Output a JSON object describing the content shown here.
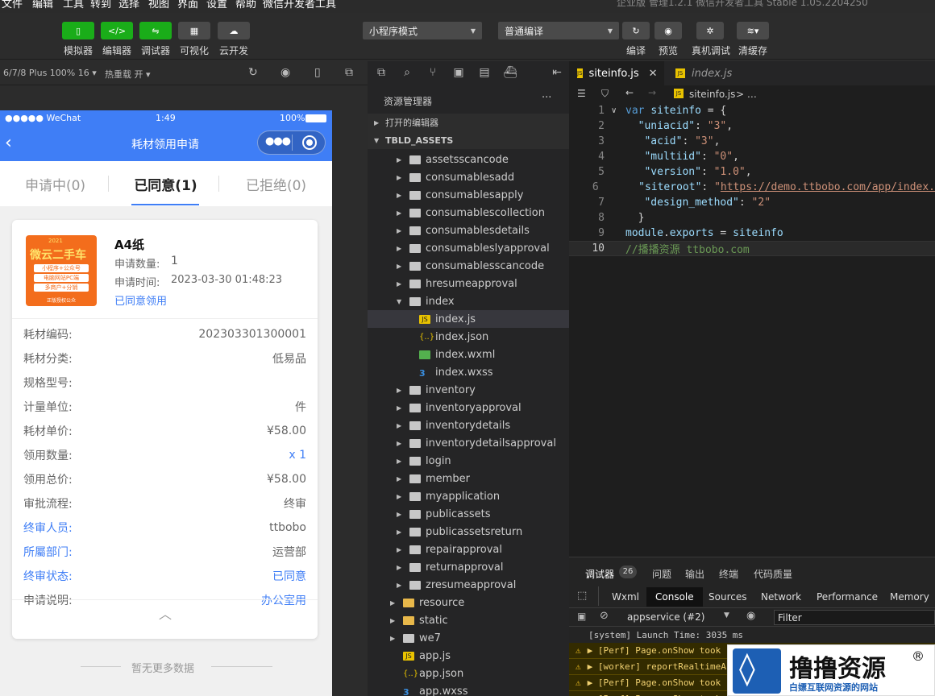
{
  "menu": {
    "items": [
      "文件",
      "编辑",
      "工具",
      "转到",
      "选择",
      "视图",
      "界面",
      "设置",
      "帮助",
      "微信开发者工具"
    ],
    "title": "企业版   管理1.2.1   微信开发者工具 Stable 1.05.2204250"
  },
  "toolbar": {
    "simulator": "模拟器",
    "editor": "编辑器",
    "debugger": "调试器",
    "visual": "可视化",
    "cloud": "云开发",
    "mode": "小程序模式",
    "compile_mode": "普通编译",
    "compile": "编译",
    "preview": "预览",
    "remote_debug": "真机调试",
    "clear_cache": "清缓存"
  },
  "simbar": {
    "device": "6/7/8 Plus 100% 16 ▾",
    "hot_reload": "热重载 开 ▾"
  },
  "phone": {
    "carrier": "●●●●● WeChat",
    "time": "1:49",
    "battery": "100%",
    "title": "耗材领用申请",
    "tabs": [
      "申请中(0)",
      "已同意(1)",
      "已拒绝(0)"
    ],
    "product_name": "A4纸",
    "qty_label": "申请数量:",
    "qty_value": "1",
    "time_label": "申请时间:",
    "time_value": "2023-03-30 01:48:23",
    "status_text": "已同意领用",
    "thumb": {
      "badge": "2021",
      "title": "微云二手车",
      "lines": [
        "小程序+公众号",
        "电脑网站PC端",
        "多商户+分销"
      ],
      "foot": "正版授权公众"
    },
    "rows": [
      {
        "label": "耗材编码:",
        "value": "202303301300001",
        "lb": false,
        "vb": false
      },
      {
        "label": "耗材分类:",
        "value": "低易品",
        "lb": false,
        "vb": false
      },
      {
        "label": "规格型号:",
        "value": "",
        "lb": false,
        "vb": false
      },
      {
        "label": "计量单位:",
        "value": "件",
        "lb": false,
        "vb": false
      },
      {
        "label": "耗材单价:",
        "value": "¥58.00",
        "lb": false,
        "vb": false
      },
      {
        "label": "领用数量:",
        "value": "x 1",
        "lb": false,
        "vb": true
      },
      {
        "label": "领用总价:",
        "value": "¥58.00",
        "lb": false,
        "vb": false
      },
      {
        "label": "审批流程:",
        "value": "终审",
        "lb": false,
        "vb": false
      },
      {
        "label": "终审人员:",
        "value": "ttbobo",
        "lb": true,
        "vb": false
      },
      {
        "label": "所屬部门:",
        "value": "运营部",
        "lb": true,
        "vb": false
      },
      {
        "label": "终审状态:",
        "value": "已同意",
        "lb": true,
        "vb": true
      },
      {
        "label": "申请说明:",
        "value": "办公室用",
        "lb": false,
        "vb": true
      }
    ],
    "no_more": "暂无更多数据"
  },
  "explorer": {
    "title": "资源管理器",
    "more": "···",
    "open_editors": "打开的编辑器",
    "project": "TBLD_ASSETS",
    "tree": [
      {
        "name": "assetsscancode",
        "depth": 2,
        "type": "folder"
      },
      {
        "name": "consumablesadd",
        "depth": 2,
        "type": "folder"
      },
      {
        "name": "consumablesapply",
        "depth": 2,
        "type": "folder"
      },
      {
        "name": "consumablescollection",
        "depth": 2,
        "type": "folder"
      },
      {
        "name": "consumablesdetails",
        "depth": 2,
        "type": "folder"
      },
      {
        "name": "consumableslyapproval",
        "depth": 2,
        "type": "folder"
      },
      {
        "name": "consumablesscancode",
        "depth": 2,
        "type": "folder"
      },
      {
        "name": "hresumeapproval",
        "depth": 2,
        "type": "folder"
      },
      {
        "name": "index",
        "depth": 2,
        "type": "open"
      },
      {
        "name": "index.js",
        "depth": 3,
        "type": "js"
      },
      {
        "name": "index.json",
        "depth": 3,
        "type": "json"
      },
      {
        "name": "index.wxml",
        "depth": 3,
        "type": "wxml"
      },
      {
        "name": "index.wxss",
        "depth": 3,
        "type": "wxss"
      },
      {
        "name": "inventory",
        "depth": 2,
        "type": "folder"
      },
      {
        "name": "inventoryapproval",
        "depth": 2,
        "type": "folder"
      },
      {
        "name": "inventorydetails",
        "depth": 2,
        "type": "folder"
      },
      {
        "name": "inventorydetailsapproval",
        "depth": 2,
        "type": "folder"
      },
      {
        "name": "login",
        "depth": 2,
        "type": "folder"
      },
      {
        "name": "member",
        "depth": 2,
        "type": "folder"
      },
      {
        "name": "myapplication",
        "depth": 2,
        "type": "folder"
      },
      {
        "name": "publicassets",
        "depth": 2,
        "type": "folder"
      },
      {
        "name": "publicassetsreturn",
        "depth": 2,
        "type": "folder"
      },
      {
        "name": "repairapproval",
        "depth": 2,
        "type": "folder"
      },
      {
        "name": "returnapproval",
        "depth": 2,
        "type": "folder"
      },
      {
        "name": "zresumeapproval",
        "depth": 2,
        "type": "folder"
      },
      {
        "name": "resource",
        "depth": 1,
        "type": "yfolder"
      },
      {
        "name": "static",
        "depth": 1,
        "type": "yfolder"
      },
      {
        "name": "we7",
        "depth": 1,
        "type": "folder"
      },
      {
        "name": "app.js",
        "depth": 1,
        "type": "js"
      },
      {
        "name": "app.json",
        "depth": 1,
        "type": "json"
      },
      {
        "name": "app.wxss",
        "depth": 1,
        "type": "wxss"
      }
    ]
  },
  "editor": {
    "tab_active": "siteinfo.js",
    "tab_other": "index.js",
    "breadcrumb": "siteinfo.js",
    "code": [
      [
        [
          "k",
          "var "
        ],
        [
          "v",
          "siteinfo"
        ],
        [
          "p",
          " = {"
        ]
      ],
      [
        [
          "p",
          "  "
        ],
        [
          "v",
          "\"uniacid\""
        ],
        [
          "p",
          ": "
        ],
        [
          "s",
          "\"3\""
        ],
        [
          "p",
          ","
        ]
      ],
      [
        [
          "p",
          "   "
        ],
        [
          "v",
          "\"acid\""
        ],
        [
          "p",
          ": "
        ],
        [
          "s",
          "\"3\""
        ],
        [
          "p",
          ","
        ]
      ],
      [
        [
          "p",
          "   "
        ],
        [
          "v",
          "\"multiid\""
        ],
        [
          "p",
          ": "
        ],
        [
          "s",
          "\"0\""
        ],
        [
          "p",
          ","
        ]
      ],
      [
        [
          "p",
          "   "
        ],
        [
          "v",
          "\"version\""
        ],
        [
          "p",
          ": "
        ],
        [
          "s",
          "\"1.0\""
        ],
        [
          "p",
          ","
        ]
      ],
      [
        [
          "p",
          "   "
        ],
        [
          "v",
          "\"siteroot\""
        ],
        [
          "p",
          ": "
        ],
        [
          "s",
          "\""
        ],
        [
          "u",
          "https://demo.ttbobo.com/app/index."
        ]
      ],
      [
        [
          "p",
          "   "
        ],
        [
          "v",
          "\"design_method\""
        ],
        [
          "p",
          ": "
        ],
        [
          "s",
          "\"2\""
        ]
      ],
      [
        [
          "p",
          "  }"
        ]
      ],
      [
        [
          "v",
          "module"
        ],
        [
          "p",
          "."
        ],
        [
          "v",
          "exports"
        ],
        [
          "p",
          " = "
        ],
        [
          "v",
          "siteinfo"
        ]
      ],
      [
        [
          "c",
          "//播播资源 ttbobo.com"
        ]
      ]
    ]
  },
  "devtools": {
    "tabs": [
      "调试器",
      "问题",
      "输出",
      "终端",
      "代码质量"
    ],
    "badge": "26",
    "console_tabs": [
      "Wxml",
      "Console",
      "Sources",
      "Network",
      "Performance",
      "Memory"
    ],
    "context": "appservice (#2)",
    "filter": "Filter",
    "logs": [
      {
        "text": "[system] Launch Time: 3035 ms",
        "warn": false
      },
      {
        "text": "▶ [Perf] Page.onShow took",
        "warn": true
      },
      {
        "text": "▶ [worker] reportRealtimeA",
        "warn": true
      },
      {
        "text": "▶ [Perf] Page.onShow took",
        "warn": true
      },
      {
        "text": "▶ [Perf] Page.onShow took",
        "warn": true
      }
    ]
  },
  "watermark": {
    "title": "撸撸资源",
    "reg": "®",
    "sub": "白嫖互联网资源的网站"
  }
}
